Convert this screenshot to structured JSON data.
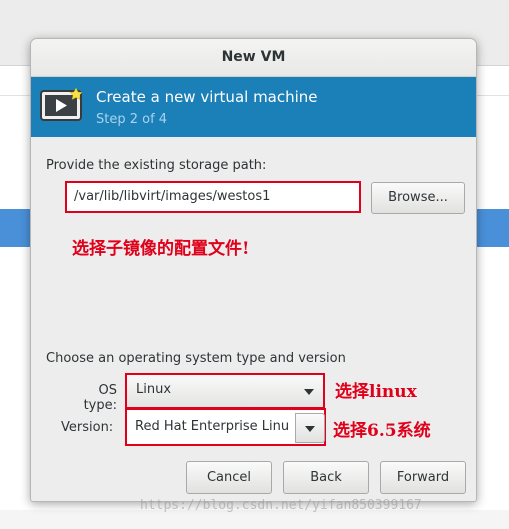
{
  "dialog": {
    "title": "New VM",
    "banner_title": "Create a new virtual machine",
    "banner_step": "Step 2 of 4",
    "banner_icon": "monitor-play-icon"
  },
  "storage": {
    "label": "Provide the existing storage path:",
    "path_value": "/var/lib/libvirt/images/westos1",
    "browse_label": "Browse..."
  },
  "os": {
    "section_label": "Choose an operating system type and version",
    "type_label": "OS type:",
    "type_value": "Linux",
    "version_label": "Version:",
    "version_value": "Red Hat Enterprise Linu"
  },
  "buttons": {
    "cancel": "Cancel",
    "back": "Back",
    "forward": "Forward"
  },
  "annotations": {
    "storage_note": "选择子镜像的配置文件!",
    "os_note": "选择linux",
    "version_note": "选择6.5系统"
  },
  "watermark": "https://blog.csdn.net/yifan850399167",
  "colors": {
    "banner": "#1b7fb8",
    "annotation_red": "#e0001b",
    "selected_row": "#4a90d9"
  }
}
